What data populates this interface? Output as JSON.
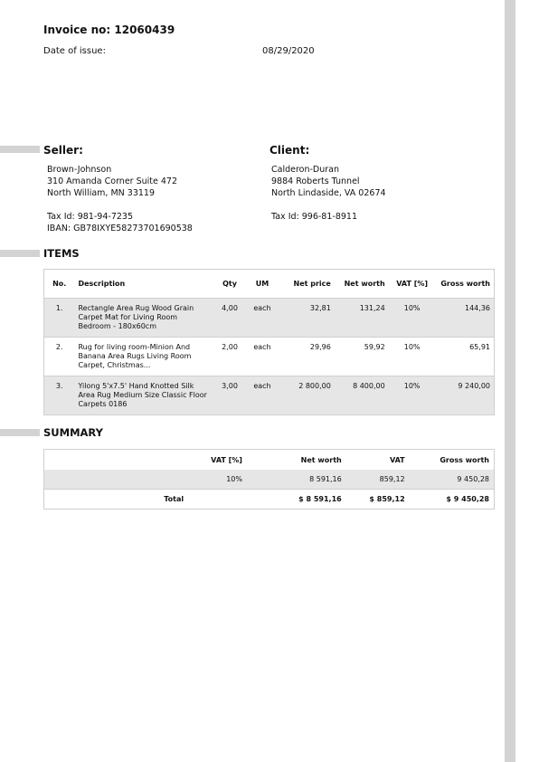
{
  "invoice": {
    "title": "Invoice no: 12060439",
    "issue_label": "Date of issue:",
    "issue_date": "08/29/2020"
  },
  "seller": {
    "heading": "Seller:",
    "name": "Brown-Johnson",
    "address1": "310 Amanda Corner Suite 472",
    "address2": "North William, MN 33119",
    "tax_id": "Tax Id: 981-94-7235",
    "iban": "IBAN: GB78IXYE58273701690538"
  },
  "client": {
    "heading": "Client:",
    "name": "Calderon-Duran",
    "address1": "9884 Roberts Tunnel",
    "address2": "North Lindaside, VA 02674",
    "tax_id": "Tax Id: 996-81-8911"
  },
  "items": {
    "heading": "ITEMS",
    "columns": [
      "No.",
      "Description",
      "Qty",
      "UM",
      "Net price",
      "Net worth",
      "VAT [%]",
      "Gross worth"
    ],
    "rows": [
      {
        "no": "1.",
        "description": "Rectangle Area Rug Wood Grain Carpet Mat for Living Room Bedroom - 180x60cm",
        "qty": "4,00",
        "um": "each",
        "net_price": "32,81",
        "net_worth": "131,24",
        "vat": "10%",
        "gross": "144,36"
      },
      {
        "no": "2.",
        "description": "Rug for living room-Minion And Banana Area Rugs Living Room Carpet, Christmas...",
        "qty": "2,00",
        "um": "each",
        "net_price": "29,96",
        "net_worth": "59,92",
        "vat": "10%",
        "gross": "65,91"
      },
      {
        "no": "3.",
        "description": "Yilong 5'x7.5' Hand Knotted Silk Area Rug Medium Size Classic Floor Carpets 0186",
        "qty": "3,00",
        "um": "each",
        "net_price": "2 800,00",
        "net_worth": "8 400,00",
        "vat": "10%",
        "gross": "9 240,00"
      }
    ]
  },
  "summary": {
    "heading": "SUMMARY",
    "columns": [
      "VAT [%]",
      "Net worth",
      "VAT",
      "Gross worth"
    ],
    "row": {
      "vat_rate": "10%",
      "net_worth": "8 591,16",
      "vat": "859,12",
      "gross": "9 450,28"
    },
    "total": {
      "label": "Total",
      "net_worth": "$ 8 591,16",
      "vat": "$ 859,12",
      "gross": "$ 9 450,28"
    }
  }
}
